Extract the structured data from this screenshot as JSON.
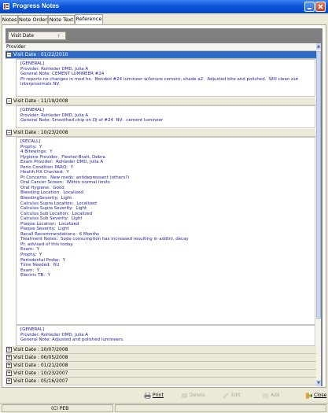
{
  "window": {
    "title": "Progress Notes"
  },
  "tabs": [
    {
      "label": "Notes"
    },
    {
      "label": "Note Order"
    },
    {
      "label": "Note Text"
    },
    {
      "label": "Reference"
    }
  ],
  "group_by": {
    "label": "Visit Date"
  },
  "grid": {
    "column_header": "Provider",
    "groups": [
      {
        "label": "Visit Date : 01/22/2010",
        "expanded": true,
        "selected": true,
        "note": "[GENERAL]\nProvider: Rohleder DMD, Julia A\nGeneral Note: CEMENT LUMINEER #24\nPt reports no changes in med hx.  Bonded #24 lumineer w/lenure cement, shade a2.  Adjusted bite and polished.  Will clean out\ninterproximals NV."
      },
      {
        "label": "Visit Date : 11/19/2008",
        "expanded": true,
        "selected": false,
        "note": "[GENERAL]\nProvider: Rohleder DMD, Julia A\nGeneral Note: Smoothed chip on DJ of #24  NV:  cement lumineer"
      },
      {
        "label": "Visit Date : 10/23/2008",
        "expanded": true,
        "selected": false,
        "note": "[RECALL]\nProphy:  Y\n4 Bitewings:  Y\nHygiene Provider:  Flesher-Bratt, Debra\nExam Provider:  Rohleder DMD, Julia A\nPerio Condition PARQ:  Y\nHealth HX Checked:  Y\nPt Concerns:  New meds: antidepressant (others?)\nOral Cancer Screen:  Within normal limits\nOral Hygiene:  Good\nBleeding Location:  Localized\nBleedingSeverity:  Light\nCalculus Supra Location:  Localized\nCalculus Supra Severity:  Light\nCalculus Sub Location:  Localized\nCalculus Sub Severity:  Light\nPlaque Location:  Localized\nPlaque Severity:  Light\nRecall Recommendations:  6 Months\nTreatment Notes:  Soda consumption has increased resulting in addtnl. decay\nPt. advised of this today.\nExam:  Y\nProphy:  Y\nPeriodontal Probe:  Y\nTime Needed:  6U\nExam:  Y\nElectric TB:  Y",
        "note2": "[GENERAL]\nProvider: Rohleder DMD, Julia A\nGeneral Note: Adjusted and polished lumineers."
      },
      {
        "label": "Visit Date : 10/07/2008",
        "expanded": false,
        "selected": false
      },
      {
        "label": "Visit Date : 06/05/2008",
        "expanded": false,
        "selected": false
      },
      {
        "label": "Visit Date : 01/21/2008",
        "expanded": false,
        "selected": false
      },
      {
        "label": "Visit Date : 10/23/2007",
        "expanded": false,
        "selected": false
      },
      {
        "label": "Visit Date : 05/16/2007",
        "expanded": false,
        "selected": false
      }
    ]
  },
  "toolbar": {
    "print": "Print",
    "delete": "Delete",
    "edit": "Edit",
    "add": "Add",
    "close": "Close"
  },
  "status": {
    "copyright": "(C) PEB"
  },
  "colors": {
    "selected_row": "#316ac5",
    "note_text": "#1c1c9c",
    "titlebar": "#0a56d8"
  }
}
